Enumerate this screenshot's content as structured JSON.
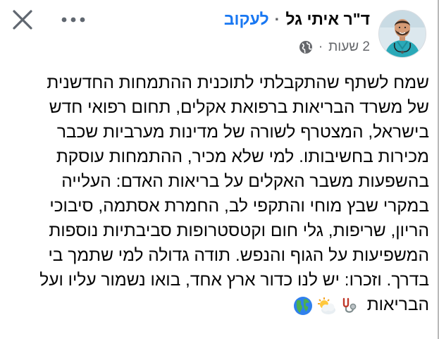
{
  "post": {
    "author_name": "ד\"ר איתי גל",
    "separator": "·",
    "follow_label": "לעקוב",
    "time": "2 שעות",
    "meta_separator": "·",
    "audience_icon": "globe-icon",
    "text_lines": [
      "שמח לשתף שהתקבלתי לתוכנית ההתמחות החדשנית",
      "של משרד הבריאות ברפואת אקלים, תחום רפואי חדש",
      "בישראל, המצטרף לשורה של מדינות מערביות שכבר",
      "מכירות בחשיבותו. למי שלא מכיר, ההתמחות עוסקת",
      "בהשפעות משבר האקלים על בריאות האדם: העלייה",
      "במקרי שבץ מוחי והתקפי לב, החמרת אסתמה, סיבוכי",
      "הריון, שריפות, גלי חום וקטסטרופות סביבתיות נוספות",
      "המשפיעות על הגוף והנפש. תודה גדולה למי שתמך בי",
      "בדרך. וזכרו: יש לנו כדור ארץ אחד, בואו נשמור עליו ועל",
      "הבריאות"
    ],
    "trailing_emojis": [
      "stethoscope-emoji",
      "sun-behind-cloud-emoji",
      "globe-americas-emoji"
    ]
  },
  "controls": {
    "close_icon": "close-icon",
    "more_icon": "more-icon"
  }
}
